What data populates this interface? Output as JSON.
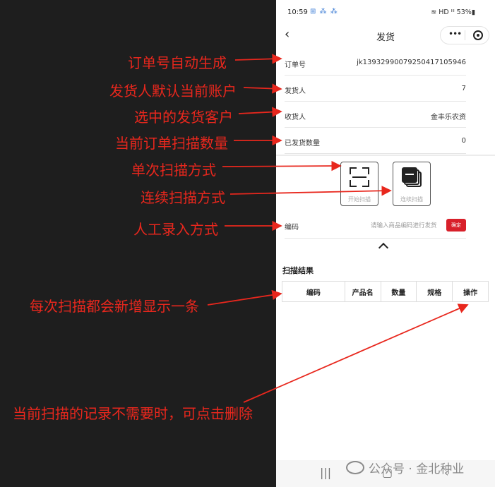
{
  "status_bar": {
    "time": "10:59",
    "notif": "⊞ ⁂ ⁂",
    "right": "≋ HD ᴵˡˡ 53%▮"
  },
  "nav": {
    "back": "‹",
    "title": "发货",
    "more": "•••"
  },
  "fields": [
    {
      "label": "订单号",
      "value": "jk13932990079250417105946"
    },
    {
      "label": "发货人",
      "value": "7"
    },
    {
      "label": "收货人",
      "value": "金丰乐农资"
    },
    {
      "label": "已发货数量",
      "value": "0"
    }
  ],
  "scan_buttons": {
    "single": "开始扫描",
    "continuous": "连续扫描"
  },
  "code_input": {
    "label": "编码",
    "placeholder": "请输入商品编码进行发货",
    "confirm": "确定"
  },
  "results": {
    "title": "扫描结果",
    "columns": [
      "编码",
      "产品名",
      "数量",
      "规格",
      "操作"
    ]
  },
  "bottom_nav": {
    "menu": "|||",
    "home": "▢",
    "back": "‹"
  },
  "watermark": "公众号 · 金北种业",
  "annotations": {
    "order_no": "订单号自动生成",
    "sender": "发货人默认当前账户",
    "customer": "选中的发货客户",
    "count": "当前订单扫描数量",
    "single": "单次扫描方式",
    "continuous": "连续扫描方式",
    "manual": "人工录入方式",
    "each_scan": "每次扫描都会新增显示一条",
    "delete": "当前扫描的记录不需要时，可点击删除"
  },
  "colors": {
    "annotation": "#e8271d",
    "confirm_button": "#d8202a",
    "background": "#1e1e1e"
  }
}
